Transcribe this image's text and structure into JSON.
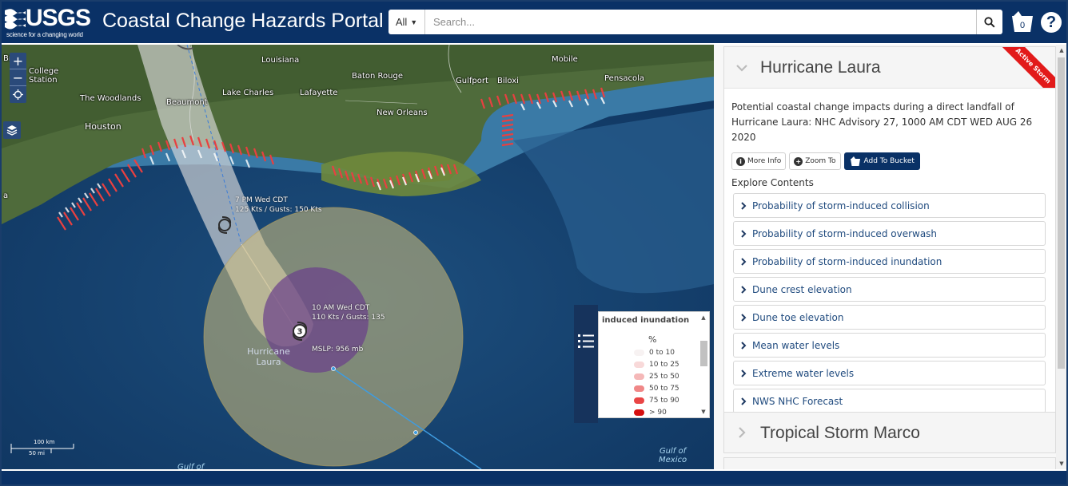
{
  "header": {
    "logo_text": "USGS",
    "logo_tagline": "science for a changing world",
    "portal_title": "Coastal Change Hazards Portal",
    "search_scope": "All",
    "search_placeholder": "Search...",
    "bucket_count": "0",
    "help_glyph": "?"
  },
  "map": {
    "labels": {
      "city_college_station": "College\nStation",
      "city_the_woodlands": "The Woodlands",
      "city_houston": "Houston",
      "city_beaumont": "Beaumont",
      "city_lake_charles": "Lake Charles",
      "city_lafayette": "Lafayette",
      "state_louisiana": "Louisiana",
      "city_baton_rouge": "Baton Rouge",
      "city_new_orleans": "New Orleans",
      "city_gulfport": "Gulfport",
      "city_biloxi": "Biloxi",
      "city_mobile": "Mobile",
      "city_pensacola": "Pensacola",
      "edge_br": "Br",
      "edge_a": "a",
      "water_gulf": "Gulf of\nMexico",
      "water_gulf_partial": "Gulf of"
    },
    "storm": {
      "forecast_time": "7 PM Wed CDT",
      "forecast_winds": "125 Kts / Gusts: 150 Kts",
      "current_time": "10 AM Wed CDT",
      "current_winds": "110 Kts / Gusts: 135",
      "storm_name": "Hurricane\nLaura",
      "mslp": "MSLP: 956 mb",
      "category": "3"
    },
    "controls": {
      "zoom_in": "+",
      "zoom_out": "−"
    },
    "scale": {
      "km": "100 km",
      "mi": "50 mi"
    },
    "legend": {
      "title": "induced inundation",
      "unit": "%",
      "items": [
        {
          "label": "0 to 10",
          "color": "#f7f2f2"
        },
        {
          "label": "10 to 25",
          "color": "#f8d9d9"
        },
        {
          "label": "25 to 50",
          "color": "#f5b8b8"
        },
        {
          "label": "50 to 75",
          "color": "#f08787"
        },
        {
          "label": "75 to 90",
          "color": "#e94545"
        },
        {
          "label": "> 90",
          "color": "#d61010"
        }
      ]
    }
  },
  "sidebar": {
    "active_card": {
      "title": "Hurricane Laura",
      "ribbon": "Active Storm",
      "description": "Potential coastal change impacts during a direct landfall of Hurricane Laura: NHC Advisory 27, 1000 AM CDT WED AUG 26 2020",
      "buttons": {
        "more_info": "More Info",
        "zoom_to": "Zoom To",
        "add_to_bucket": "Add To Bucket"
      },
      "explore_label": "Explore Contents",
      "contents": [
        "Probability of storm-induced collision",
        "Probability of storm-induced overwash",
        "Probability of storm-induced inundation",
        "Dune crest elevation",
        "Dune toe elevation",
        "Mean water levels",
        "Extreme water levels",
        "NWS NHC Forecast"
      ]
    },
    "second_card": {
      "title": "Tropical Storm Marco"
    }
  },
  "colors": {
    "header_bg": "#0a3166",
    "link": "#1f4a7e",
    "ribbon": "#e21a1a"
  }
}
